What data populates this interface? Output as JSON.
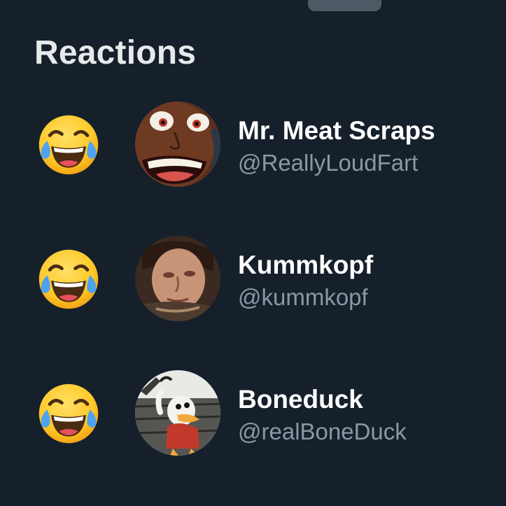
{
  "sheet": {
    "title": "Reactions"
  },
  "reactions": [
    {
      "reaction_icon": "face-with-tears-of-joy-icon",
      "name": "Mr. Meat Scraps",
      "handle": "@ReallyLoudFart"
    },
    {
      "reaction_icon": "face-with-tears-of-joy-icon",
      "name": "Kummkopf",
      "handle": "@kummkopf"
    },
    {
      "reaction_icon": "face-with-tears-of-joy-icon",
      "name": "Boneduck",
      "handle": "@realBoneDuck"
    }
  ],
  "colors": {
    "background": "#15202b",
    "primary_text": "#ffffff",
    "secondary_text": "#8b98a5",
    "grabber": "#4e5965"
  }
}
